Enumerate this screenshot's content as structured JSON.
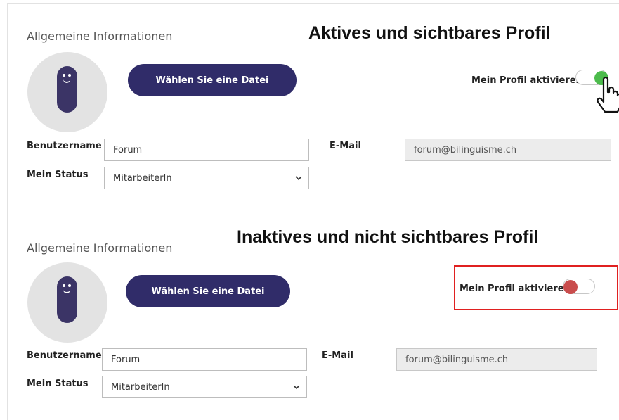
{
  "active_profile": {
    "caption": "Aktives und sichtbares Profil",
    "section_title": "Allgemeine Informationen",
    "choose_file_label": "Wählen Sie eine Datei",
    "toggle_label": "Mein Profil aktivieren",
    "toggle_on": true,
    "knob_color": "#4cbb4c",
    "username_label": "Benutzername",
    "username_value": "Forum",
    "status_label": "Mein Status",
    "status_value": "MitarbeiterIn",
    "email_label": "E-Mail",
    "email_value": "forum@bilinguisme.ch"
  },
  "inactive_profile": {
    "caption": "Inaktives und nicht sichtbares Profil",
    "section_title": "Allgemeine Informationen",
    "choose_file_label": "Wählen Sie eine Datei",
    "toggle_label": "Mein Profil aktivieren",
    "toggle_on": false,
    "knob_color": "#c94c4c",
    "username_label": "Benutzername",
    "username_value": "Forum",
    "status_label": "Mein Status",
    "status_value": "MitarbeiterIn",
    "email_label": "E-Mail",
    "email_value": "forum@bilinguisme.ch"
  },
  "colors": {
    "button_bg": "#302c69",
    "avatar_bg": "#e3e3e3",
    "avatar_figure": "#3b3466",
    "highlight_border": "#e02020"
  },
  "icons": {
    "avatar": "smiley-figure-icon",
    "select_chevron": "chevron-down-icon",
    "cursor": "mouse-pointer-icon"
  }
}
